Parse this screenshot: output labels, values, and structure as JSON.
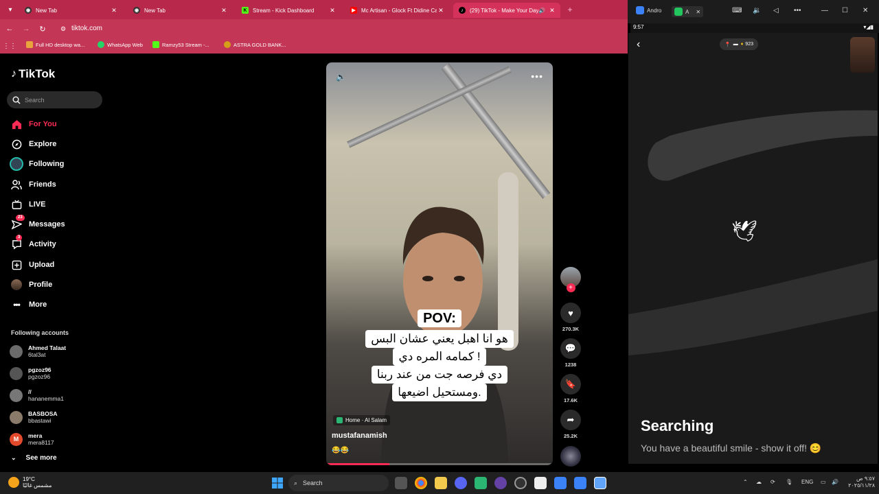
{
  "browser": {
    "tabs": [
      {
        "title": "New Tab",
        "icon": "globe-icon",
        "color": "#333"
      },
      {
        "title": "New Tab",
        "icon": "globe-icon",
        "color": "#333"
      },
      {
        "title": "Stream - Kick Dashboard",
        "icon": "kick-icon",
        "color": "#53fc18"
      },
      {
        "title": "Mc Artisan - Glock Ft Didine Ca",
        "icon": "youtube-icon",
        "color": "#ff0000"
      },
      {
        "title": "(29) TikTok - Make Your Day",
        "icon": "tiktok-icon",
        "color": "#000"
      }
    ],
    "url": "tiktok.com",
    "bookmarks": [
      {
        "label": "Full HD desktop wa...",
        "color": "#e8a33d"
      },
      {
        "label": "WhatsApp Web",
        "color": "#25d366"
      },
      {
        "label": "Ramzy53 Stream -...",
        "color": "#53fc18"
      },
      {
        "label": "ASTRA GOLD BANK...",
        "color": "#d4a017"
      }
    ]
  },
  "tiktok": {
    "logo": "TikTok",
    "search_placeholder": "Search",
    "nav": [
      {
        "label": "For You",
        "icon": "home-icon",
        "active": true
      },
      {
        "label": "Explore",
        "icon": "compass-icon"
      },
      {
        "label": "Following",
        "icon": "following-icon"
      },
      {
        "label": "Friends",
        "icon": "friends-icon"
      },
      {
        "label": "LIVE",
        "icon": "live-icon"
      },
      {
        "label": "Messages",
        "icon": "messages-icon",
        "badge": "23"
      },
      {
        "label": "Activity",
        "icon": "activity-icon",
        "badge": "3"
      },
      {
        "label": "Upload",
        "icon": "upload-icon"
      },
      {
        "label": "Profile",
        "icon": "profile-icon"
      },
      {
        "label": "More",
        "icon": "more-icon"
      }
    ],
    "following_title": "Following accounts",
    "accounts": [
      {
        "name": "Ahmed Talaat",
        "handle": "6tal3at",
        "color": "#6b6b6b",
        "initial": ""
      },
      {
        "name": "pgzoz96",
        "handle": "pgzoz96",
        "color": "#555",
        "initial": ""
      },
      {
        "name": "//",
        "handle": "hananemma1",
        "color": "#777",
        "initial": ""
      },
      {
        "name": "BASBOSA",
        "handle": "bbastawi",
        "color": "#8a7a6a",
        "initial": ""
      },
      {
        "name": "mera",
        "handle": "mera8117",
        "color": "#e24a2b",
        "initial": "M"
      }
    ],
    "see_more": "See more",
    "video": {
      "caption_title": "POV:",
      "caption_lines": [
        "هو انا اهبل يعني عشان البس",
        "كمامه المره دي !",
        "دي فرصه جت من عند ربنا",
        "ومستحيل اضيعها."
      ],
      "location": "Home · Al Salam",
      "author": "mustafanamish",
      "emojis": "😂😂",
      "progress": 0.28
    },
    "actions": {
      "likes": "270.3K",
      "comments": "1238",
      "saves": "17.6K",
      "shares": "25.2K"
    }
  },
  "android": {
    "tabs": [
      {
        "label": "Andro",
        "color": "#3b82f6"
      },
      {
        "label": "A",
        "color": "#22c55e"
      }
    ],
    "time": "9:57",
    "gem_count": "923",
    "status_title": "Searching",
    "status_message": "You have a beautiful smile - show it off! 😊"
  },
  "taskbar": {
    "temperature": "19°C",
    "weather_text": "مشمس غالبًا",
    "search_label": "Search",
    "language": "ENG",
    "time": "٩:٥٧ ص",
    "date": "٢٠٢٥/١١/٢٨"
  }
}
